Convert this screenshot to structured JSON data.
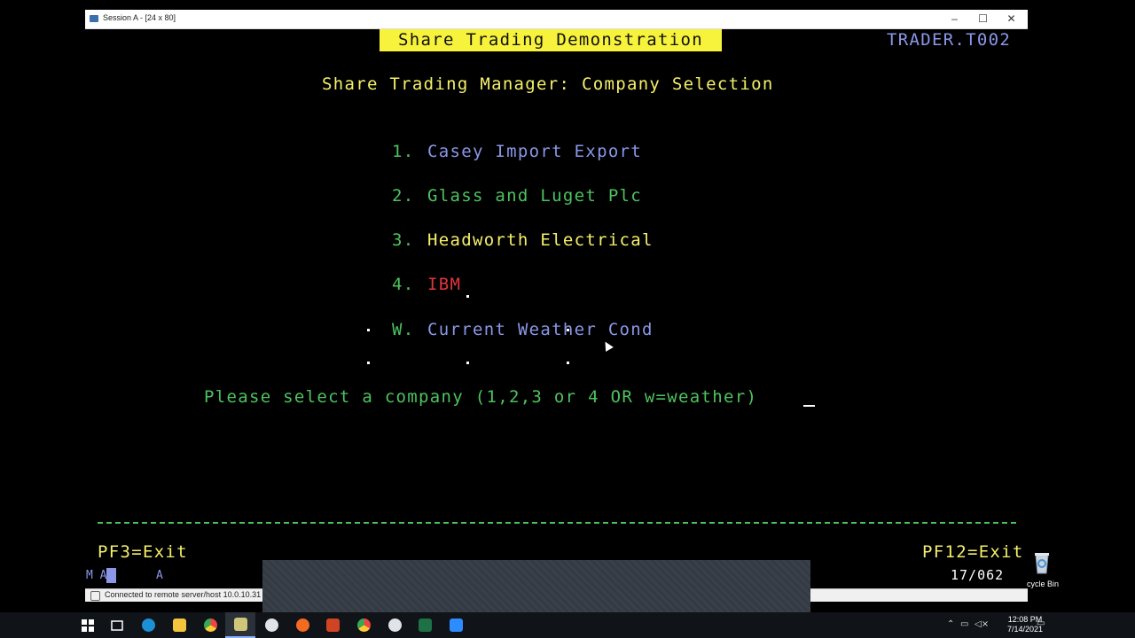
{
  "window": {
    "title": "Session A - [24 x 80]",
    "minimize": "–",
    "maximize": "☐",
    "close": "✕"
  },
  "terminal": {
    "banner": "Share Trading Demonstration",
    "transaction_id": "TRADER.T002",
    "heading": "Share Trading Manager: Company Selection",
    "options": [
      {
        "num": "1.",
        "label": "Casey Import Export"
      },
      {
        "num": "2.",
        "label": "Glass and Luget Plc"
      },
      {
        "num": "3.",
        "label": "Headworth Electrical"
      },
      {
        "num": "4.",
        "label": "IBM"
      },
      {
        "num": "W.",
        "label": "Current Weather Cond"
      }
    ],
    "prompt": "Please select a company (1,2,3 or 4 OR w=weather)",
    "pf3": "PF3=Exit",
    "pf12": "PF12=Exit"
  },
  "status": {
    "oia_mode": "M A",
    "oia_a": "A",
    "cursor_position": "17/062",
    "connection": "Connected to remote server/host 10.0.10.31 usin"
  },
  "desktop": {
    "recycle_bin": "cycle Bin"
  },
  "taskbar": {
    "time": "12:08 PM",
    "date": "7/14/2021",
    "icons": [
      "windows-start-icon",
      "task-view-icon",
      "edge-icon",
      "file-explorer-icon",
      "chrome-icon",
      "terminal-app-icon",
      "app-icon",
      "app-orange-icon",
      "powerpoint-icon",
      "chrome-icon-2",
      "app-icon-2",
      "excel-icon",
      "zoom-icon"
    ]
  },
  "colors": {
    "yellow": "#f5f06a",
    "green": "#4cc35e",
    "blue": "#8a97e8",
    "red": "#e0363d"
  }
}
